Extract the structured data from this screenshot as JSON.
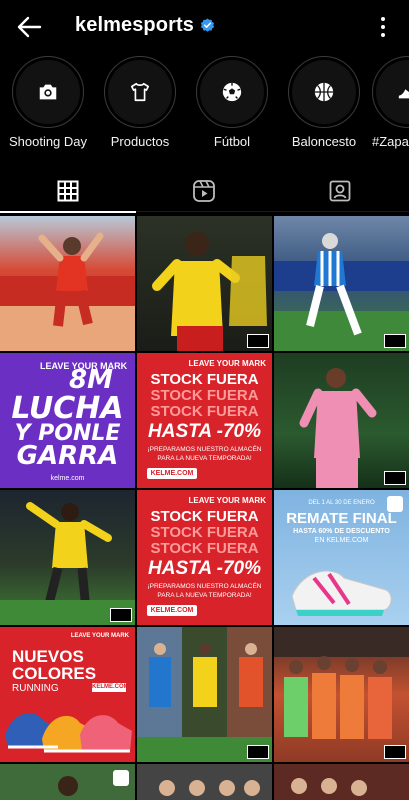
{
  "header": {
    "username": "kelmesports",
    "back_icon": "arrow-left-icon",
    "verified_icon": "verified-badge-icon",
    "more_icon": "more-vertical-icon"
  },
  "highlights": [
    {
      "label": "Shooting Day",
      "icon": "camera-icon"
    },
    {
      "label": "Productos",
      "icon": "tshirt-icon"
    },
    {
      "label": "Fútbol",
      "icon": "soccer-ball-icon"
    },
    {
      "label": "Baloncesto",
      "icon": "basketball-icon"
    },
    {
      "label": "#Zapa",
      "icon": "shoe-icon"
    }
  ],
  "tabs": [
    {
      "name": "posts",
      "icon": "grid-icon",
      "active": true
    },
    {
      "name": "reels",
      "icon": "reels-icon",
      "active": false
    },
    {
      "name": "tagged",
      "icon": "tagged-person-icon",
      "active": false
    }
  ],
  "posts": {
    "p4": {
      "line1": "8M",
      "line2": "LUCHA",
      "line3": "Y PONLE",
      "line4": "GARRA",
      "footer": "kelme.com"
    },
    "p5": {
      "l1": "STOCK FUERA",
      "l2": "STOCK FUERA",
      "l3": "STOCK FUERA",
      "hasta": "HASTA -70%",
      "sub1": "¡PREPARAMOS NUESTRO ALMACÉN",
      "sub2": "PARA LA NUEVA TEMPORADA!",
      "btn": "KELME.COM"
    },
    "p8": {
      "l1": "STOCK FUERA",
      "l2": "STOCK FUERA",
      "l3": "STOCK FUERA",
      "hasta": "HASTA -70%",
      "sub1": "¡PREPARAMOS NUESTRO ALMACÉN",
      "sub2": "PARA LA NUEVA TEMPORADA!",
      "btn": "KELME.COM"
    },
    "p9": {
      "top": "DEL 1 AL 30 DE ENERO",
      "title": "REMATE FINAL",
      "sub1": "HASTA 60% DE DESCUENTO",
      "sub2": "EN KELME.COM"
    },
    "p10": {
      "l1": "NUEVOS",
      "l2": "COLORES",
      "l3": "RUNNING",
      "btn": "KELME.COM"
    }
  },
  "colors": {
    "background": "#000000",
    "accent_blue": "#3897f0",
    "kelme_red": "#d8232a"
  }
}
